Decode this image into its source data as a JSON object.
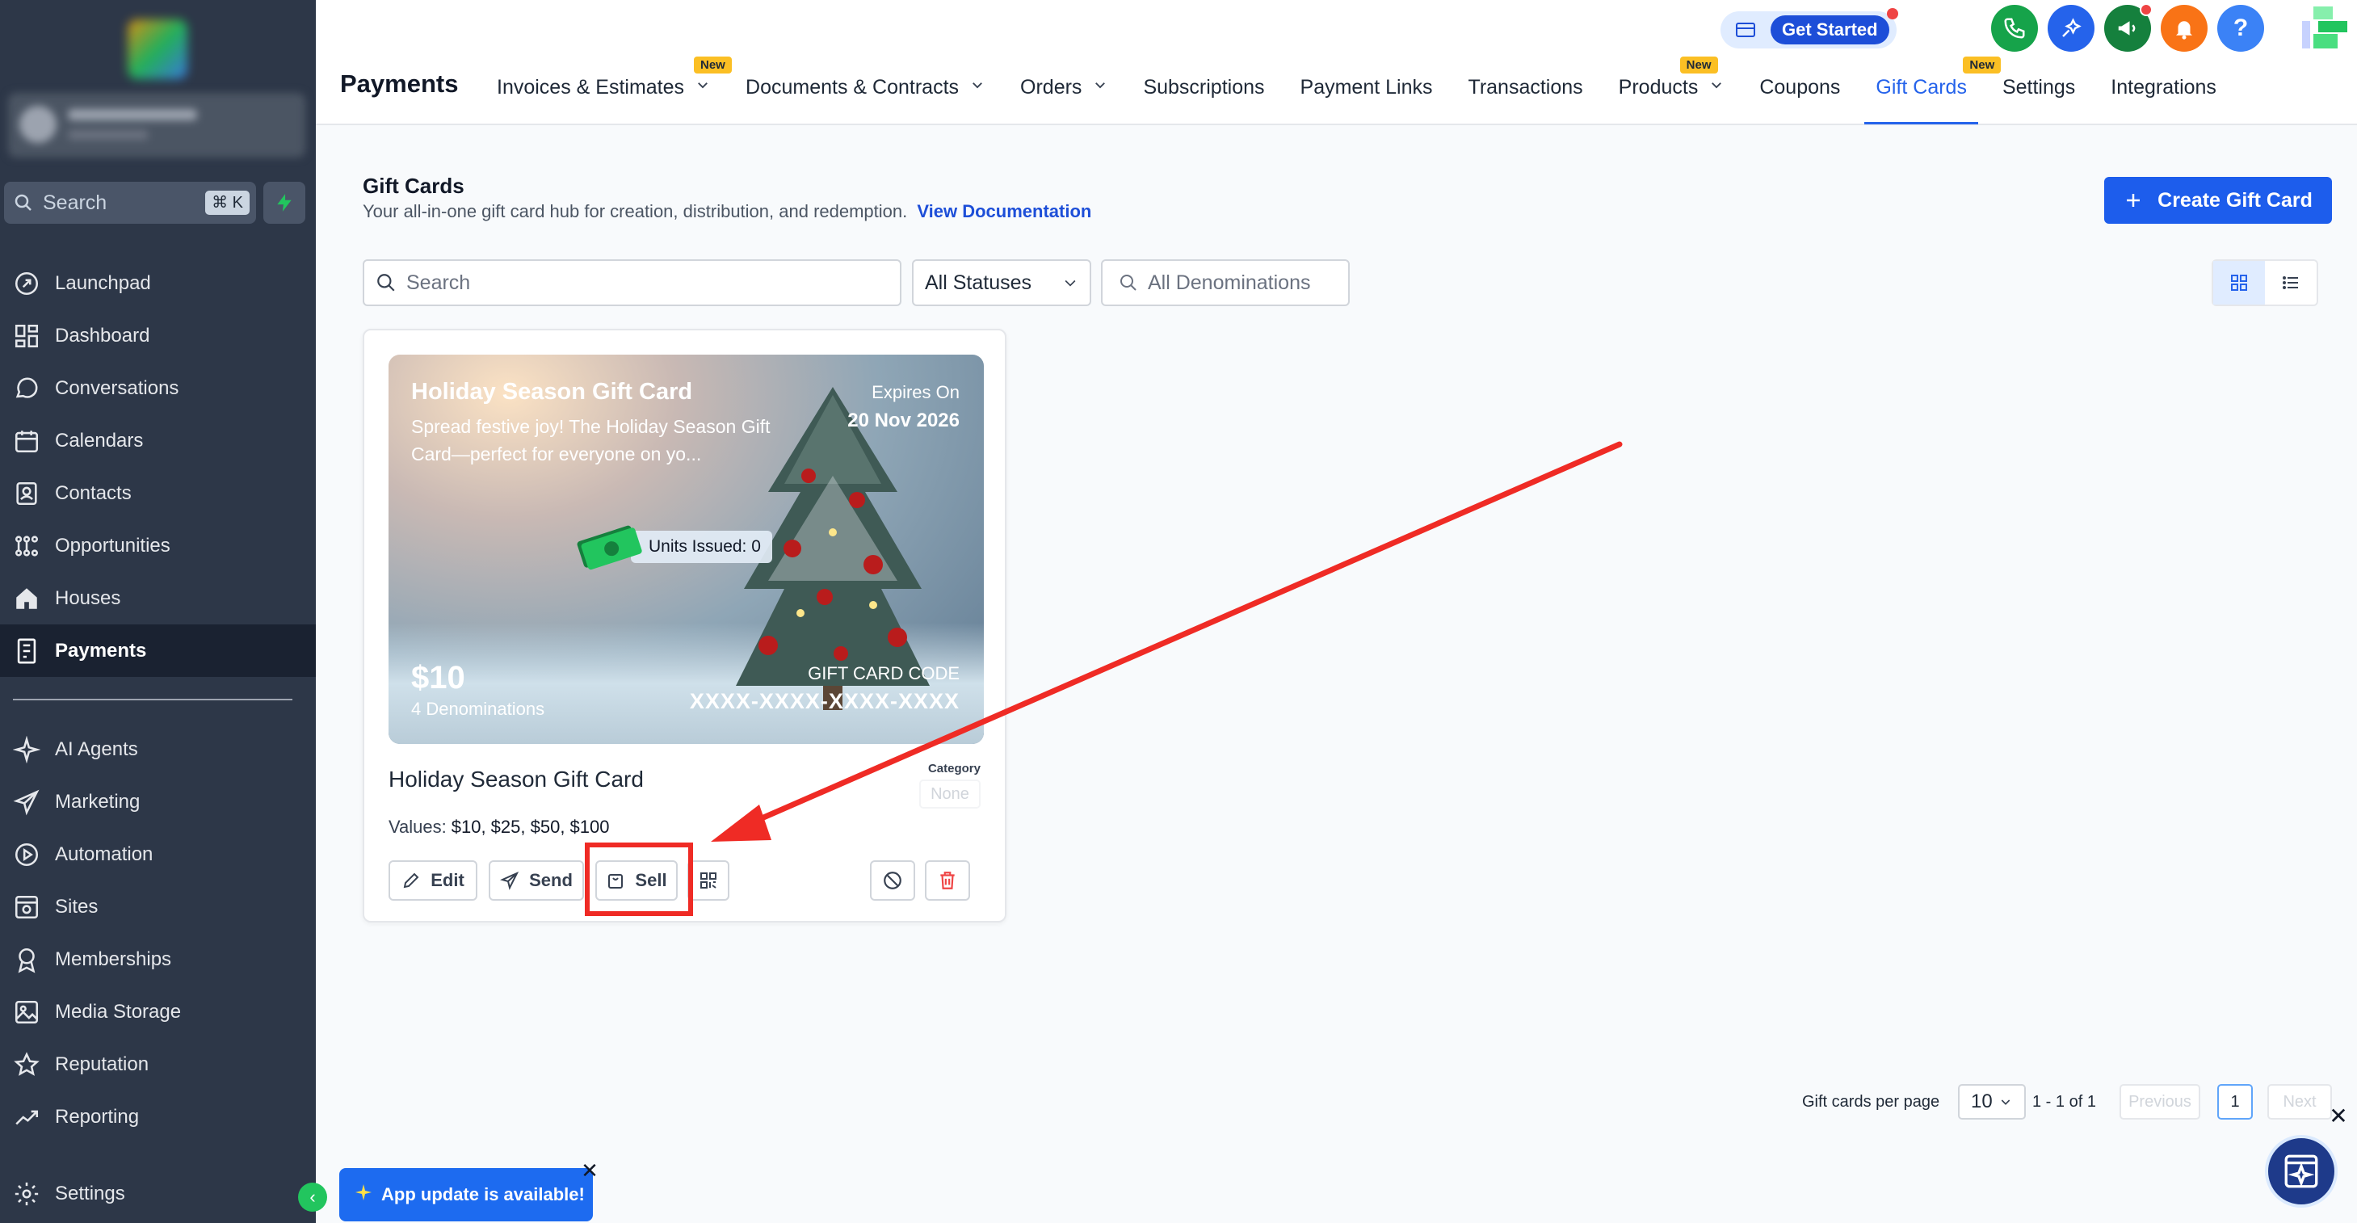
{
  "sidebar": {
    "search_placeholder": "Search",
    "search_shortcut": "⌘ K",
    "items_top": [
      {
        "label": "Launchpad",
        "icon": "rocket-icon"
      },
      {
        "label": "Dashboard",
        "icon": "dashboard-icon"
      },
      {
        "label": "Conversations",
        "icon": "chat-icon"
      },
      {
        "label": "Calendars",
        "icon": "calendar-icon"
      },
      {
        "label": "Contacts",
        "icon": "contacts-icon"
      },
      {
        "label": "Opportunities",
        "icon": "opportunities-icon"
      },
      {
        "label": "Houses",
        "icon": "house-icon"
      },
      {
        "label": "Payments",
        "icon": "payments-icon",
        "active": true
      }
    ],
    "items_bottom": [
      {
        "label": "AI Agents",
        "icon": "sparkle-icon"
      },
      {
        "label": "Marketing",
        "icon": "send-icon"
      },
      {
        "label": "Automation",
        "icon": "automation-icon"
      },
      {
        "label": "Sites",
        "icon": "sites-icon"
      },
      {
        "label": "Memberships",
        "icon": "membership-icon"
      },
      {
        "label": "Media Storage",
        "icon": "image-icon"
      },
      {
        "label": "Reputation",
        "icon": "star-icon"
      },
      {
        "label": "Reporting",
        "icon": "chart-icon"
      }
    ],
    "settings_label": "Settings"
  },
  "topbar": {
    "get_started": "Get Started",
    "help_label": "?"
  },
  "header": {
    "module_title": "Payments",
    "new_badge": "New",
    "tabs": [
      {
        "label": "Invoices & Estimates",
        "dropdown": true,
        "badge": true
      },
      {
        "label": "Documents & Contracts",
        "dropdown": true
      },
      {
        "label": "Orders",
        "dropdown": true
      },
      {
        "label": "Subscriptions"
      },
      {
        "label": "Payment Links"
      },
      {
        "label": "Transactions"
      },
      {
        "label": "Products",
        "dropdown": true,
        "badge": true
      },
      {
        "label": "Coupons"
      },
      {
        "label": "Gift Cards",
        "active": true,
        "badge": true
      },
      {
        "label": "Settings"
      },
      {
        "label": "Integrations"
      }
    ]
  },
  "page": {
    "title": "Gift Cards",
    "description": "Your all-in-one gift card hub for creation, distribution, and redemption.",
    "doc_link": "View Documentation",
    "create_button": "Create Gift Card",
    "filters": {
      "search_placeholder": "Search",
      "status_value": "All Statuses",
      "denomination_placeholder": "All Denominations"
    }
  },
  "card": {
    "image_title": "Holiday Season Gift Card",
    "image_description": "Spread festive joy! The Holiday Season Gift Card—perfect for everyone on yo...",
    "expires_label": "Expires On",
    "expires_date": "20 Nov 2026",
    "units_issued": "Units Issued: 0",
    "price": "$10",
    "denominations": "4 Denominations",
    "code_label": "GIFT CARD CODE",
    "code": "XXXX-XXXX-XXXX-XXXX",
    "name": "Holiday Season Gift Card",
    "category_label": "Category",
    "category_value": "None",
    "values_label": "Values:",
    "values": "$10, $25, $50, $100",
    "actions": {
      "edit": "Edit",
      "send": "Send",
      "sell": "Sell"
    }
  },
  "pagination": {
    "per_page_label": "Gift cards per page",
    "per_page_value": "10",
    "range": "1 - 1 of 1",
    "previous": "Previous",
    "page": "1",
    "next": "Next"
  },
  "toast": {
    "message": "App update is available!"
  },
  "colors": {
    "primary": "#1d5dec",
    "sidebar": "#2d3748",
    "annotation": "#ef2b25"
  }
}
